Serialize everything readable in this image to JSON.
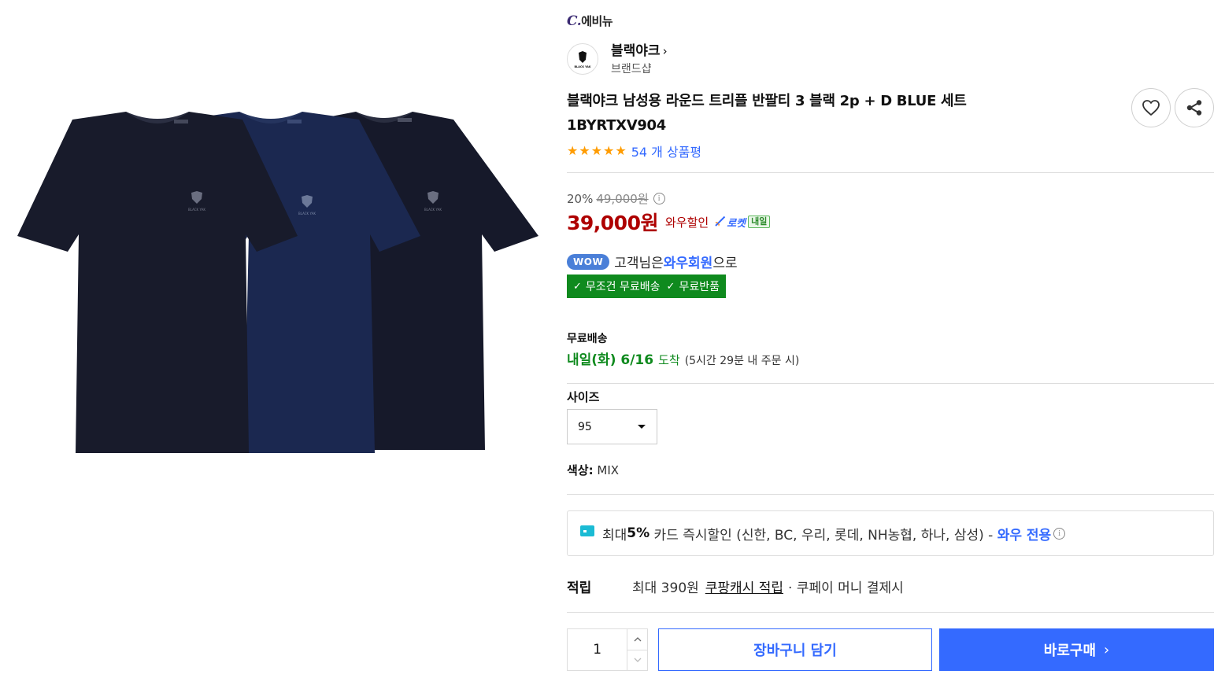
{
  "product": {
    "image_alt": "블랙야크 반팔티 3종 세트",
    "sub_brand_prefix": "C.",
    "sub_brand_name": "에비뉴",
    "brand_name": "블랙야크",
    "brand_chevron": "›",
    "brand_sub": "브랜드샵",
    "brand_logo_text": "BLACK YAK",
    "title_line1": "블랙야크 남성용 라운드 트리플 반팔티 3 블랙 2p + D BLUE 세트",
    "title_line2": "1BYRTXV904",
    "stars": 5,
    "review_count_text": "54 개 상품평"
  },
  "price": {
    "discount_rate": "20%",
    "original": "49,000원",
    "info_glyph": "i",
    "sale": "39,000원",
    "wow_discount_label": "와우할인",
    "rocket_label": "로켓",
    "tomorrow_badge": "내일"
  },
  "wow": {
    "badge": "WOW",
    "text_before": "고객님은 ",
    "member_label": "와우회원",
    "text_after": "으로",
    "free_shipping": "무조건 무료배송",
    "free_return": "무료반품"
  },
  "shipping": {
    "label": "무료배송",
    "arrival_date": "내일(화) 6/16",
    "arrival_suffix": "도착",
    "arrival_note": "(5시간 29분 내 주문 시)"
  },
  "options": {
    "size_label": "사이즈",
    "size_value": "95",
    "color_label": "색상:",
    "color_value": "MIX"
  },
  "card_promo": {
    "prefix": "최대 ",
    "rate": "5%",
    "text": " 카드 즉시할인 (신한, BC, 우리, 롯데, NH농협, 하나, 삼성) - ",
    "wow_only": "와우 전용",
    "info_glyph": "i"
  },
  "reward": {
    "label": "적립",
    "amount_text": "최대 390원",
    "link_text": "쿠팡캐시 적립",
    "note": "· 쿠페이 머니 결제시"
  },
  "purchase": {
    "quantity": "1",
    "cart_label": "장바구니 담기",
    "buy_label": "바로구매",
    "buy_arrow": "›"
  },
  "colors": {
    "accent": "#346aff",
    "sale_red": "#ae0000",
    "rocket_green": "#0f8a1e",
    "star": "#ff9c00",
    "wow_badge": "#4a7fd8"
  },
  "icons": [
    "heart-icon",
    "share-icon",
    "info-icon",
    "rocket-icon",
    "check-icon",
    "card-icon",
    "chevron-up-icon",
    "chevron-down-icon",
    "chevron-right-icon"
  ]
}
